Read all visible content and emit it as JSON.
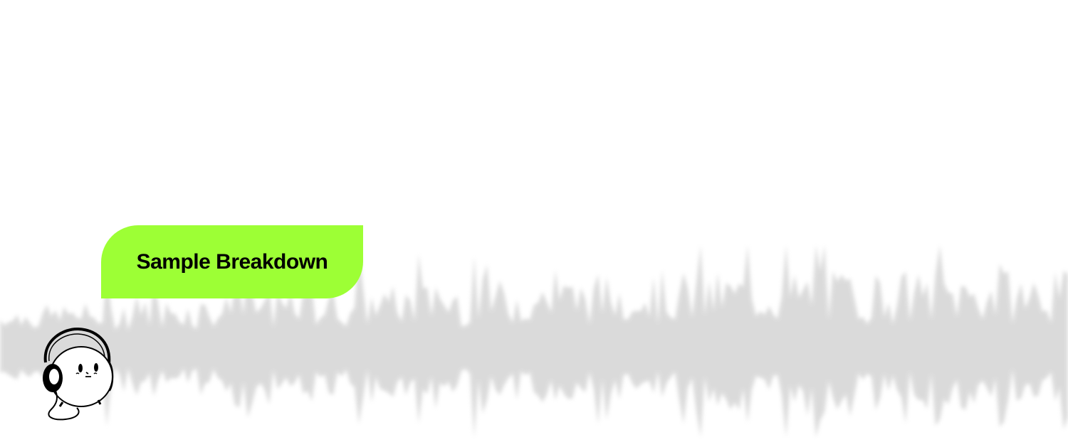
{
  "button": {
    "label": "Sample Breakdown"
  },
  "mascot": {
    "icon": "headphones-mascot-icon"
  },
  "colors": {
    "accent": "#9dff35",
    "waveform": "#d9d9d9",
    "background": "#ffffff",
    "text": "#000000"
  }
}
